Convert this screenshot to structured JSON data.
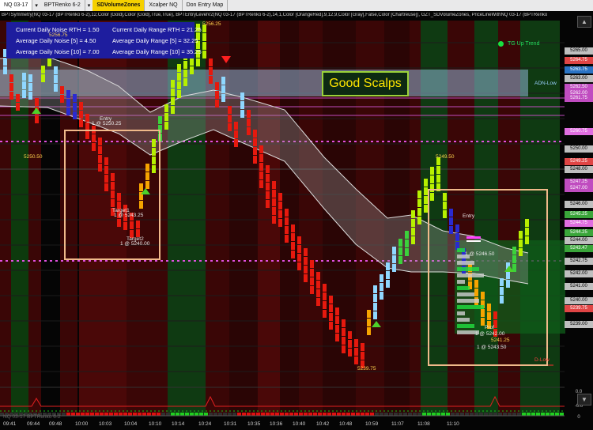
{
  "window": {
    "tabs": [
      {
        "label": "NQ 03-17",
        "active": true
      },
      {
        "label": "BPTRenko 6-2",
        "active": false
      },
      {
        "label": "SDVolumeZones",
        "active": false,
        "highlight": true
      },
      {
        "label": "Xcalper NQ",
        "active": false
      },
      {
        "label": "Don Entry Map",
        "active": false
      }
    ],
    "dropdown_glyph": "▾"
  },
  "indicator_line": {
    "text": "BPTSymmetry(NQ 03-17 (BPTRenko 6-2),12,Color [Gold],Color [Gold],True,True), BPTEntryLevelV2(NQ 03-17 (BPTRenko 6-2),14,1,Color [OrangeRed],9,12,9,Color [Gray],False,Color [Chartreuse]), GZT_SDVolumeZones, PriceLineWithNQ 03-17 (BPTRenko"
  },
  "noise_panel": {
    "items": [
      {
        "label": "Current Daily Noise RTH = 1.50"
      },
      {
        "label": "Current Daily Range RTH = 21.25"
      },
      {
        "label": "Average Daily Noise [5] = 4.50"
      },
      {
        "label": "Average Daily Range [5] = 32.25"
      },
      {
        "label": "Average Daily Noise [10] = 7.00"
      },
      {
        "label": "Average Daily Range [10] = 35.25"
      }
    ],
    "bg_color": "#1e1d9e"
  },
  "banner": {
    "text": "Good Scalps",
    "border_color": "#9bd23a",
    "text_color": "#ffe600"
  },
  "trend": {
    "label": "TG Up Trend",
    "color": "#18e040"
  },
  "adn_label": "ADN-Low",
  "dlow_label": "D-Low",
  "price_axis": {
    "labels": [
      {
        "text": "5265.00",
        "color": "#bfbfbf"
      },
      {
        "text": "5264.75",
        "color": "#e04545"
      },
      {
        "text": "5263.75",
        "color": "#2a73c4"
      },
      {
        "text": "5263.00",
        "color": "#bfbfbf"
      },
      {
        "text": "5262.50",
        "color": "#c04cc0"
      },
      {
        "text": "5262.00",
        "color": "#c04cc0"
      },
      {
        "text": "5261.75",
        "color": "#c04cc0"
      },
      {
        "text": "5260.75",
        "color": "#e06de0"
      },
      {
        "text": "5250.00",
        "color": "#bfbfbf"
      },
      {
        "text": "5249.25",
        "color": "#e04545"
      },
      {
        "text": "5248.00",
        "color": "#bfbfbf"
      },
      {
        "text": "5247.25",
        "color": "#c04cc0"
      },
      {
        "text": "5247.00",
        "color": "#c04cc0"
      },
      {
        "text": "5246.00",
        "color": "#bfbfbf"
      },
      {
        "text": "5245.25",
        "color": "#3aa53a"
      },
      {
        "text": "5244.75",
        "color": "#e06de0"
      },
      {
        "text": "5244.25",
        "color": "#3aa53a"
      },
      {
        "text": "5244.00",
        "color": "#bfbfbf"
      },
      {
        "text": "5243.47",
        "color": "#3aa53a"
      },
      {
        "text": "5242.75",
        "color": "#bfbfbf"
      },
      {
        "text": "5242.00",
        "color": "#bfbfbf"
      },
      {
        "text": "5241.00",
        "color": "#bfbfbf"
      },
      {
        "text": "5240.00",
        "color": "#bfbfbf"
      },
      {
        "text": "5239.75",
        "color": "#e04545"
      },
      {
        "text": "5239.00",
        "color": "#bfbfbf"
      }
    ],
    "sub_labels": [
      "0.0",
      "-0.0",
      "0"
    ]
  },
  "time_axis": {
    "labels": [
      "09:41",
      "09:44",
      "09:48",
      "10:00",
      "10:03",
      "10:04",
      "10:10",
      "10:14",
      "10:24",
      "10:31",
      "10:35",
      "10:36",
      "10:40",
      "10:42",
      "10:48",
      "10:59",
      "11:07",
      "11:08",
      "11:10"
    ]
  },
  "annotations": {
    "price_marks": [
      {
        "text": "5256.75",
        "color": "#ffd34d"
      },
      {
        "text": "5256.25",
        "color": "#ffd34d"
      },
      {
        "text": "5250.50",
        "color": "#ffd34d"
      },
      {
        "text": "5249.50",
        "color": "#ffd34d"
      },
      {
        "text": "5239.75",
        "color": "#ffd34d"
      }
    ],
    "trades": [
      {
        "text": "Entry",
        "color": "#e8e8e8"
      },
      {
        "text": "1 @ 5250.25",
        "color": "#e8e8e8"
      },
      {
        "text": "Target1",
        "color": "#e8e8e8"
      },
      {
        "text": "1 @ 5243.25",
        "color": "#e8e8e8"
      },
      {
        "text": "Target2",
        "color": "#e8e8e8"
      },
      {
        "text": "1 @ 5240.00",
        "color": "#e8e8e8"
      },
      {
        "text": "Entry",
        "color": "#e8e8e8"
      },
      {
        "text": "1 @ 5246.50",
        "color": "#e8e8e8"
      },
      {
        "text": "Prof",
        "color": "#e8e8e8"
      },
      {
        "text": "1 @ 5242.00",
        "color": "#e8e8e8"
      },
      {
        "text": "5241.25",
        "color": "#ffd34d"
      },
      {
        "text": "1 @ 5243.50",
        "color": "#e8e8e8"
      }
    ],
    "bottom_text": "NQ 03-17 BPTRenko 6-2"
  },
  "side_buttons": [
    "▲",
    "▼"
  ],
  "colors": {
    "bull_bright": "#b7f000",
    "bull": "#3bd23b",
    "bull_light": "#8fd7ff",
    "bear": "#e6190e",
    "bear_dark": "#2a2ad0",
    "orange": "#f6a400",
    "band": "#8a8a8a"
  }
}
